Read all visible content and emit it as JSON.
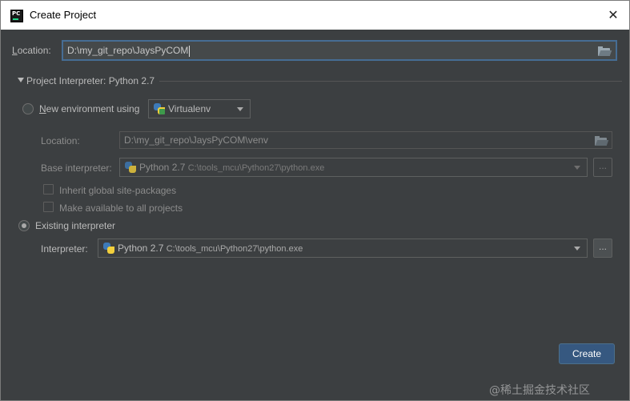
{
  "window": {
    "title": "Create Project"
  },
  "location": {
    "label_prefix": "",
    "label_mnemonic": "L",
    "label_rest": "ocation:",
    "value": "D:\\my_git_repo\\JaysPyCOM"
  },
  "interpreter_section": {
    "header": "Project Interpreter: Python 2.7"
  },
  "new_env": {
    "label_mnemonic": "N",
    "label_rest": "ew environment using",
    "tool": "Virtualenv",
    "location_label": "Location:",
    "location_value": "D:\\my_git_repo\\JaysPyCOM\\venv",
    "base_interpreter_label": "Base interpreter:",
    "base_interpreter_name": "Python 2.7",
    "base_interpreter_path": "C:\\tools_mcu\\Python27\\python.exe",
    "inherit_label": "Inherit global site-packages",
    "make_available_label": "Make available to all projects"
  },
  "existing": {
    "label": "Existing interpreter",
    "interpreter_label": "Interpreter:",
    "interpreter_name": "Python 2.7",
    "interpreter_path": "C:\\tools_mcu\\Python27\\python.exe"
  },
  "buttons": {
    "browse": "...",
    "create": "Create"
  },
  "watermark": "@稀土掘金技术社区",
  "colors": {
    "background": "#3c3f41",
    "accent": "#365880",
    "focus_border": "#466d94"
  }
}
